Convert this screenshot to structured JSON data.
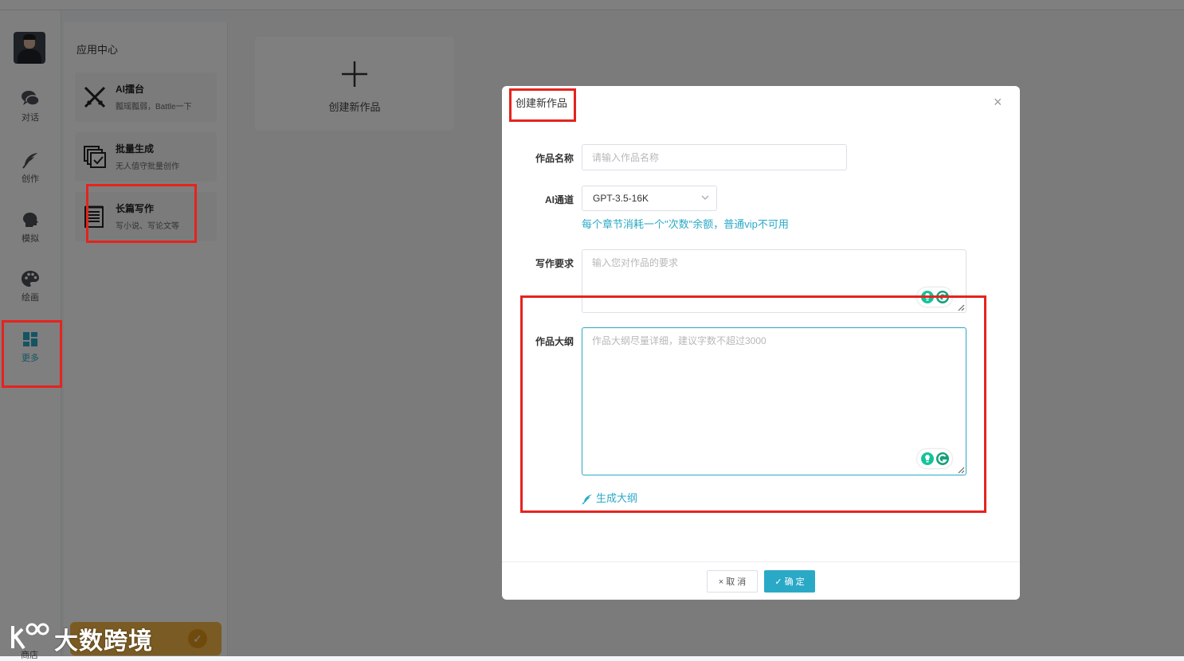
{
  "sidebar": {
    "items": [
      {
        "label": "对话",
        "icon": "chat-bubbles-icon"
      },
      {
        "label": "创作",
        "icon": "feather-icon"
      },
      {
        "label": "模拟",
        "icon": "head-profile-icon"
      },
      {
        "label": "绘画",
        "icon": "palette-icon"
      },
      {
        "label": "更多",
        "icon": "grid-icon",
        "active": true
      }
    ],
    "partial_label": "商店"
  },
  "app_center": {
    "title": "应用中心",
    "apps": [
      {
        "title": "AI擂台",
        "desc": "瓢瑶瓢弱，Battle一下",
        "icon": "crossed-swords-icon"
      },
      {
        "title": "批量生成",
        "desc": "无人值守批量创作",
        "icon": "batch-check-icon"
      },
      {
        "title": "长篇写作",
        "desc": "写小说、写论文等",
        "icon": "document-icon"
      }
    ]
  },
  "main": {
    "new_work_label": "创建新作品"
  },
  "dialog": {
    "title": "创建新作品",
    "name_label": "作品名称",
    "name_placeholder": "请输入作品名称",
    "channel_label": "AI通道",
    "channel_value": "GPT-3.5-16K",
    "channel_hint": "每个章节消耗一个\"次数\"余额，普通vip不可用",
    "req_label": "写作要求",
    "req_placeholder": "输入您对作品的要求",
    "outline_label": "作品大纲",
    "outline_placeholder": "作品大纲尽量详细，建议字数不超过3000",
    "generate_label": "生成大纲",
    "cancel_label": "取 消",
    "ok_label": "确 定",
    "close_symbol": "×"
  },
  "watermark": {
    "text": "大数跨境"
  },
  "colors": {
    "accent": "#2aa9c7",
    "highlight": "#e5231e",
    "overlay": "rgba(0,0,0,0.5)"
  }
}
